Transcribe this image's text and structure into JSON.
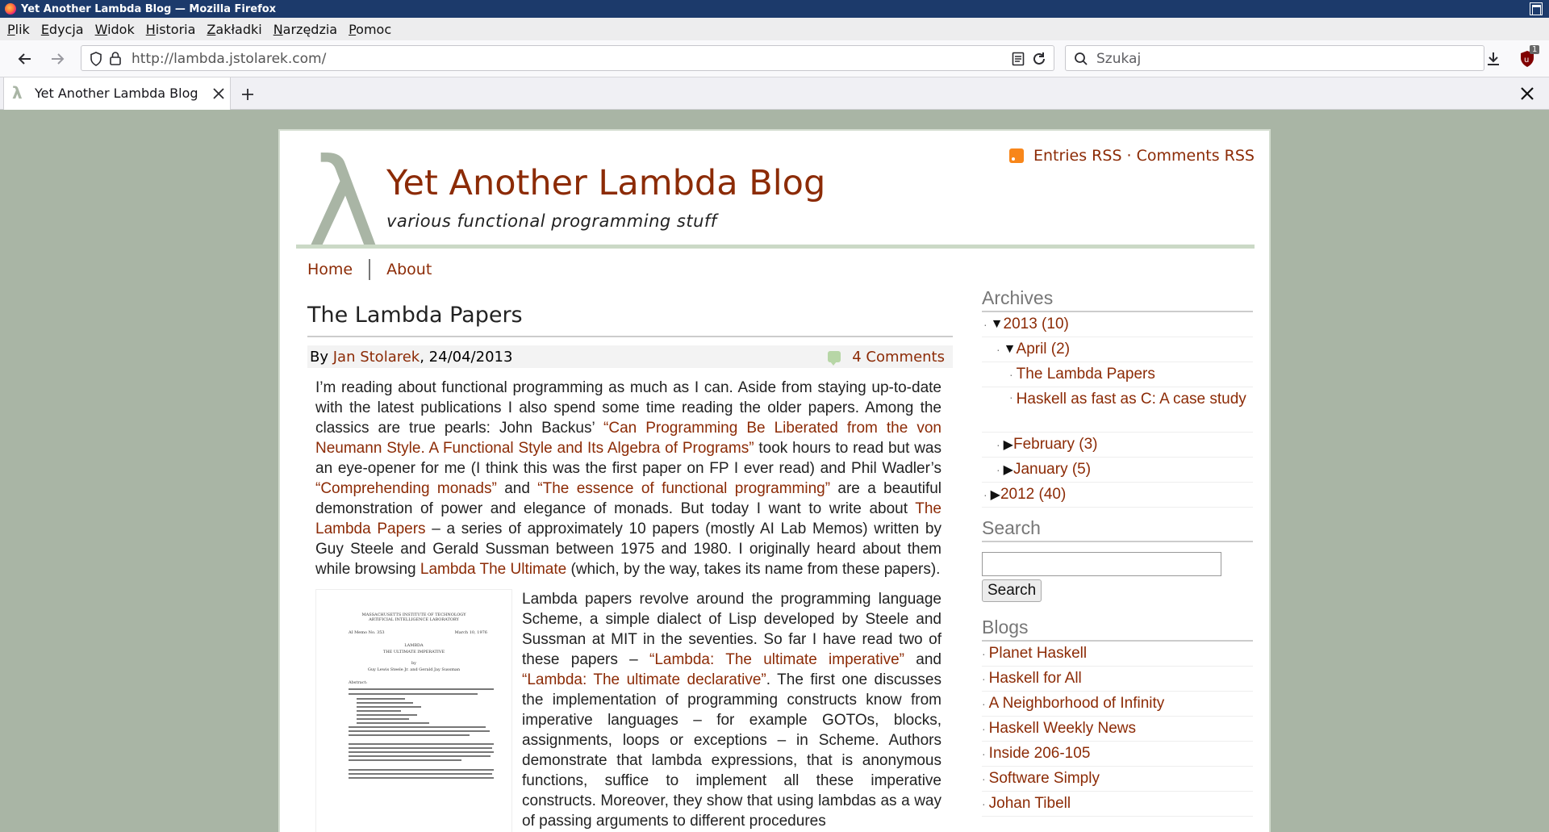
{
  "window": {
    "title": "Yet Another Lambda Blog — Mozilla Firefox"
  },
  "menu": [
    "Plik",
    "Edycja",
    "Widok",
    "Historia",
    "Zakładki",
    "Narzędzia",
    "Pomoc"
  ],
  "nav": {
    "url": "http://lambda.jstolarek.com/",
    "search_placeholder": "Szukaj",
    "addon_badge": "1"
  },
  "tab": {
    "title": "Yet Another Lambda Blog",
    "favicon": "λ"
  },
  "blog": {
    "logo": "λ",
    "title": "Yet Another Lambda Blog",
    "tagline": "various functional programming stuff",
    "rss_entries": "Entries RSS",
    "rss_sep": " · ",
    "rss_comments": "Comments RSS",
    "nav": [
      "Home",
      "About"
    ]
  },
  "post": {
    "title": "The Lambda Papers",
    "by": "By ",
    "author": "Jan Stolarek",
    "date": ", 24/04/2013",
    "comments": "4 Comments",
    "p1": [
      {
        "t": "I’m reading about functional programming as much as I can. Aside from staying up-to-date with the latest publications I also spend some time reading the older papers. Among the classics are true pearls: John Backus’ "
      },
      {
        "t": "“Can Programming Be Liberated from the von Neumann Style. A Functional Style and Its Algebra of Programs”",
        "link": true
      },
      {
        "t": " took hours to read but was an eye-opener for me (I think this was the first paper on FP I ever read) and Phil Wadler’s "
      },
      {
        "t": "“Comprehending monads”",
        "link": true
      },
      {
        "t": " and "
      },
      {
        "t": "“The essence of functional programming”",
        "link": true
      },
      {
        "t": " are a beautiful demonstration of power and elegance of monads. But today I want to write about "
      },
      {
        "t": "The Lambda Papers",
        "link": true
      },
      {
        "t": " – a series of approximately 10 papers (mostly AI Lab Memos) written by Guy Steele and Gerald Sussman between 1975 and 1980. I originally heard about them while browsing "
      },
      {
        "t": "Lambda The Ultimate",
        "link": true
      },
      {
        "t": " (which, by the way, takes its name from these papers)."
      }
    ],
    "p2": [
      {
        "t": "Lambda papers revolve around the programming language Scheme, a simple dialect of Lisp developed by Steele and Sussman at MIT in the seventies. So far I have read two of these papers – "
      },
      {
        "t": "“Lambda: The ultimate imperative”",
        "link": true
      },
      {
        "t": " and "
      },
      {
        "t": "“Lambda: The ultimate declarative”",
        "link": true
      },
      {
        "t": ". The first one discusses the implementation of programming constructs know from imperative languages – for example GOTOs, blocks, assignments, loops or exceptions – in Scheme. Authors demonstrate that lambda expressions, that is anonymous functions, suffice to implement all these imperative constructs. Moreover, they show that using lambdas as a way of passing arguments to different procedures"
      }
    ],
    "paper_image": {
      "header1": "MASSACHUSETTS INSTITUTE OF TECHNOLOGY",
      "header2": "ARTIFICIAL INTELLIGENCE LABORATORY",
      "memo": "AI Memo No. 353",
      "date": "March 10, 1976",
      "title1": "LAMBDA",
      "title2": "THE ULTIMATE IMPERATIVE",
      "by": "by",
      "authors": "Guy Lewis Steele Jr. and Gerald Jay Sussman",
      "abstract": "Abstract:"
    }
  },
  "sidebar": {
    "archives_title": "Archives",
    "archives": [
      {
        "label": "2013 (10)",
        "tri": "▼",
        "indent": 0
      },
      {
        "label": "April (2)",
        "tri": "▼",
        "indent": 1
      },
      {
        "label": "The Lambda Papers",
        "tri": "",
        "indent": 2
      },
      {
        "label": "Haskell as fast as C: A case study",
        "tri": "",
        "indent": 2
      },
      {
        "label": "February (3)",
        "tri": "▶",
        "indent": 1
      },
      {
        "label": "January (5)",
        "tri": "▶",
        "indent": 1
      },
      {
        "label": "2012 (40)",
        "tri": "▶",
        "indent": 0
      }
    ],
    "search_title": "Search",
    "search_button": "Search",
    "blogs_title": "Blogs",
    "blogs": [
      "Planet Haskell",
      "Haskell for All",
      "A Neighborhood of Infinity",
      "Haskell Weekly News",
      "Inside 206-105",
      "Software Simply",
      "Johan Tibell"
    ]
  }
}
